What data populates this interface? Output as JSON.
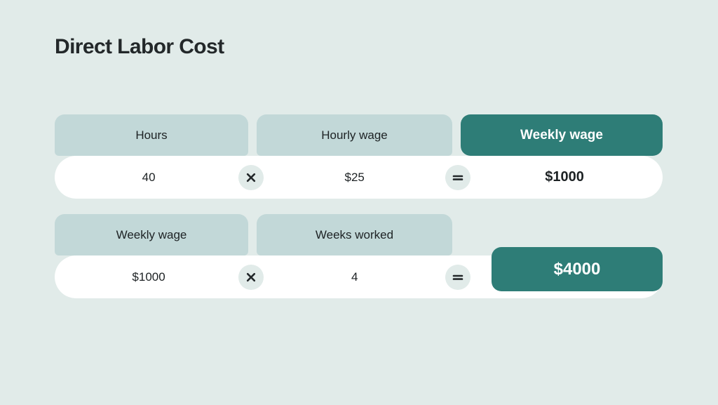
{
  "title": "Direct Labor Cost",
  "theme": {
    "background": "#e1ebe9",
    "header_cell": "#c2d8d8",
    "accent": "#2e7d77",
    "pill": "#ffffff",
    "text": "#1d2224"
  },
  "rows": [
    {
      "id": "weekly-wage",
      "headers": [
        {
          "label": "Hours",
          "accent": false
        },
        {
          "label": "Hourly wage",
          "accent": false
        },
        {
          "label": "Weekly wage",
          "accent": true
        }
      ],
      "values": [
        {
          "text": "40",
          "strong": false
        },
        {
          "text": "$25",
          "strong": false
        },
        {
          "text": "$1000",
          "strong": true
        }
      ],
      "operators": [
        {
          "name": "multiply-icon",
          "symbol": "×"
        },
        {
          "name": "equals-icon",
          "symbol": "="
        }
      ]
    },
    {
      "id": "direct-labor-cost",
      "headers": [
        {
          "label": "Weekly wage",
          "accent": false
        },
        {
          "label": "Weeks worked",
          "accent": false
        }
      ],
      "values": [
        {
          "text": "$1000",
          "strong": false
        },
        {
          "text": "4",
          "strong": false
        },
        {
          "text": "",
          "strong": false
        }
      ],
      "operators": [
        {
          "name": "multiply-icon",
          "symbol": "×"
        },
        {
          "name": "equals-icon",
          "symbol": "="
        }
      ],
      "result": {
        "label": "$4000"
      }
    }
  ]
}
